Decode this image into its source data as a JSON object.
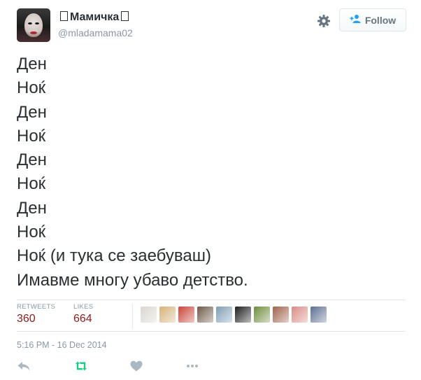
{
  "tweet": {
    "author": {
      "display_name": "Мамичка",
      "handle": "@mladamama02"
    },
    "follow_label": "Follow",
    "lines": [
      "Ден",
      "Ноќ",
      "Ден",
      "Ноќ",
      "Ден",
      "Ноќ",
      "Ден",
      "Ноќ",
      "Ноќ (и тука се заебуваш)",
      "Имавме многу убаво детство."
    ],
    "stats": {
      "retweets_label": "RETWEETS",
      "retweets_count": "360",
      "likes_label": "LIKES",
      "likes_count": "664"
    },
    "timestamp": "5:16 PM - 16 Dec 2014",
    "liker_avatar_colors": [
      "#d9d6cf",
      "#d6b27a",
      "#c9453a",
      "#6f5a4a",
      "#7f9db5",
      "#1d1d1d",
      "#6f8d3e",
      "#a0624a",
      "#d98b84",
      "#5c6f92"
    ]
  },
  "icons": {
    "settings": "gear-icon",
    "follow": "add-user-icon",
    "reply": "reply-icon",
    "retweet": "retweet-icon",
    "like": "heart-icon",
    "more": "more-icon"
  },
  "colors": {
    "stat_number": "#8c1c1c",
    "retweet_active": "#19cf86",
    "muted": "#8899a6"
  }
}
